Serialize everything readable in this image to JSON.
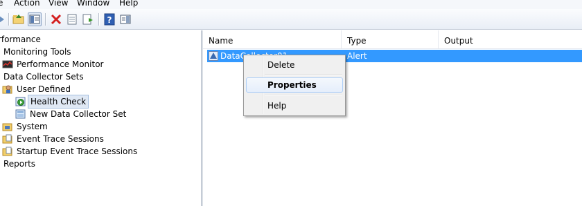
{
  "menu": {
    "items": [
      "e",
      "Action",
      "View",
      "Window",
      "Help"
    ]
  },
  "toolbar": {
    "buttons": [
      "back-arrow-icon",
      "up-folder-icon",
      "show-hide-tree-icon",
      "delete-icon",
      "properties-icon",
      "export-list-icon",
      "help-icon",
      "action-pane-icon"
    ]
  },
  "tree": {
    "items": [
      {
        "label": "rformance",
        "icon": "none"
      },
      {
        "label": "Monitoring Tools",
        "icon": "none"
      },
      {
        "label": "Performance Monitor",
        "icon": "perf-monitor-icon"
      },
      {
        "label": "Data Collector Sets",
        "icon": "none"
      },
      {
        "label": "User Defined",
        "icon": "folder-user-icon"
      },
      {
        "label": "Health Check",
        "icon": "data-collector-running-icon"
      },
      {
        "label": "New Data Collector Set",
        "icon": "data-collector-icon"
      },
      {
        "label": "System",
        "icon": "folder-icon"
      },
      {
        "label": "Event Trace Sessions",
        "icon": "folder-icon"
      },
      {
        "label": "Startup Event Trace Sessions",
        "icon": "folder-icon"
      },
      {
        "label": "Reports",
        "icon": "none"
      }
    ]
  },
  "list": {
    "columns": [
      "Name",
      "Type",
      "Output"
    ],
    "rows": [
      {
        "name": "DataCollector01",
        "type": "Alert",
        "output": ""
      }
    ]
  },
  "context_menu": {
    "items": [
      "Delete",
      "Properties",
      "Help"
    ],
    "highlighted": "Properties"
  },
  "colors": {
    "selection": "#3399ff",
    "menu_hot_border": "#aecff7"
  }
}
